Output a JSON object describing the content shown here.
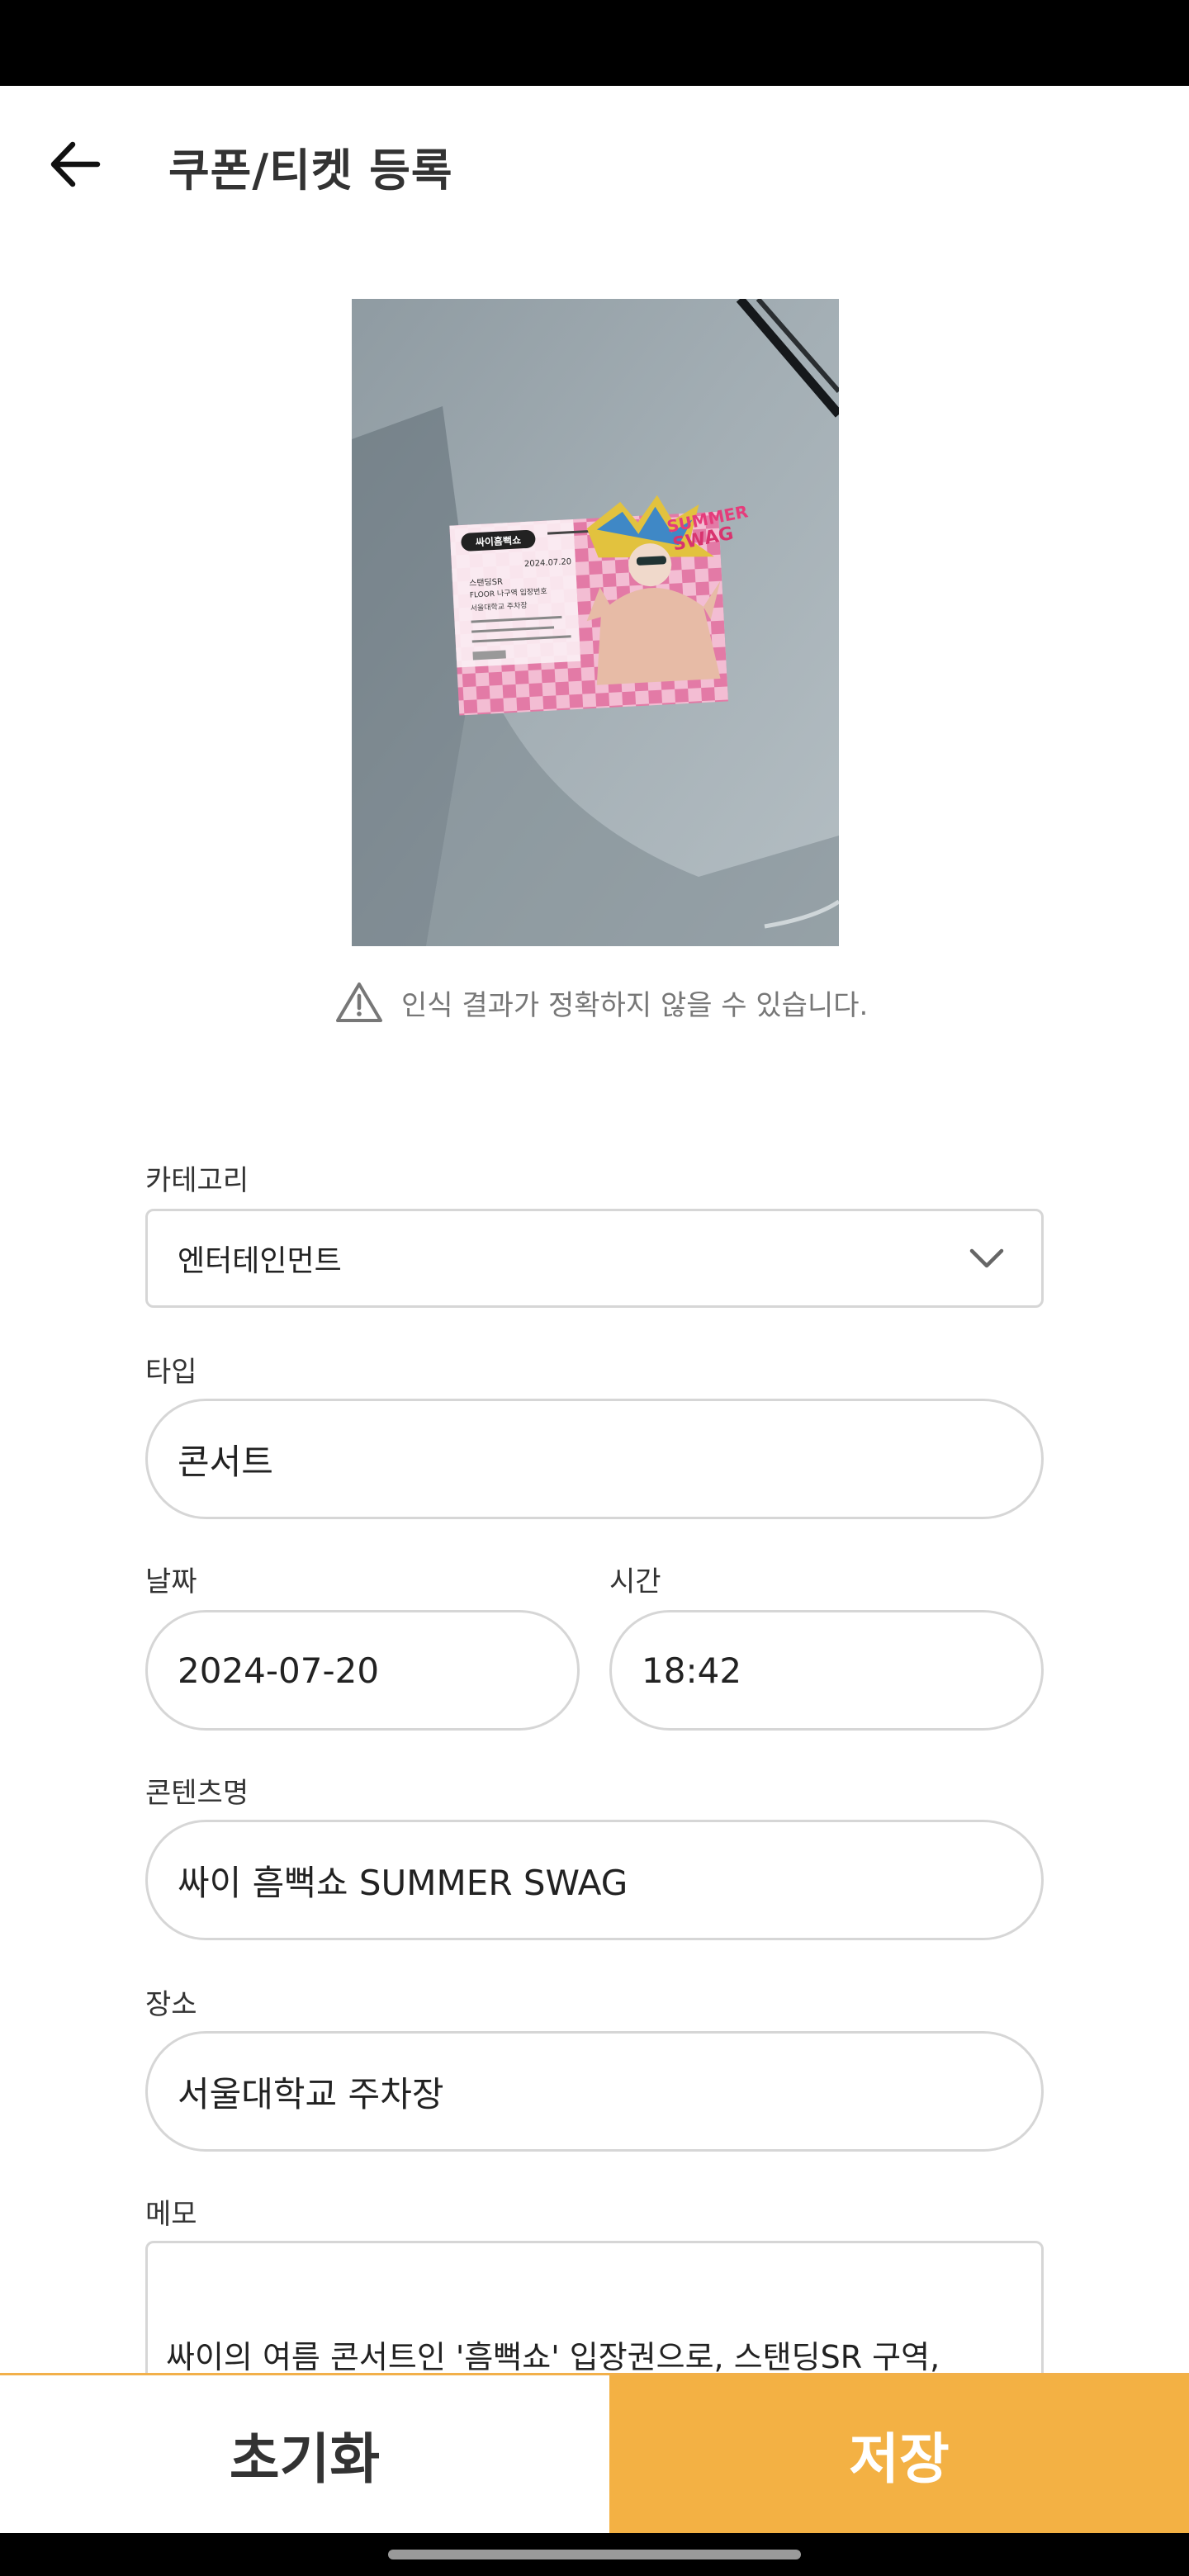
{
  "header": {
    "title": "쿠폰/티켓 등록"
  },
  "photo": {
    "ticket_brand": "싸이흠뻑쇼",
    "ticket_title_line1": "SUMMER",
    "ticket_title_line2": "SWAG",
    "ticket_date": "2024.07.20",
    "ticket_venue": "서울대학교 주차장",
    "ticket_area": "스탠딩SR",
    "ticket_section": "FLOOR 나구역 입장번호"
  },
  "warning": {
    "text": "인식 결과가 정확하지 않을 수 있습니다."
  },
  "form": {
    "category": {
      "label": "카테고리",
      "value": "엔터테인먼트"
    },
    "type": {
      "label": "타입",
      "value": "콘서트"
    },
    "date": {
      "label": "날짜",
      "value": "2024-07-20"
    },
    "time": {
      "label": "시간",
      "value": "18:42"
    },
    "content_name": {
      "label": "콘텐츠명",
      "value": "싸이 흠뻑쇼 SUMMER SWAG"
    },
    "place": {
      "label": "장소",
      "value": "서울대학교 주차장"
    },
    "memo": {
      "label": "메모",
      "value": "싸이의 여름 콘서트인 '흠뻑쇼' 입장권으로, 스탠딩SR 구역,"
    }
  },
  "actions": {
    "reset_label": "초기화",
    "save_label": "저장"
  },
  "colors": {
    "accent": "#f3b144",
    "border": "#d6d6d6"
  }
}
